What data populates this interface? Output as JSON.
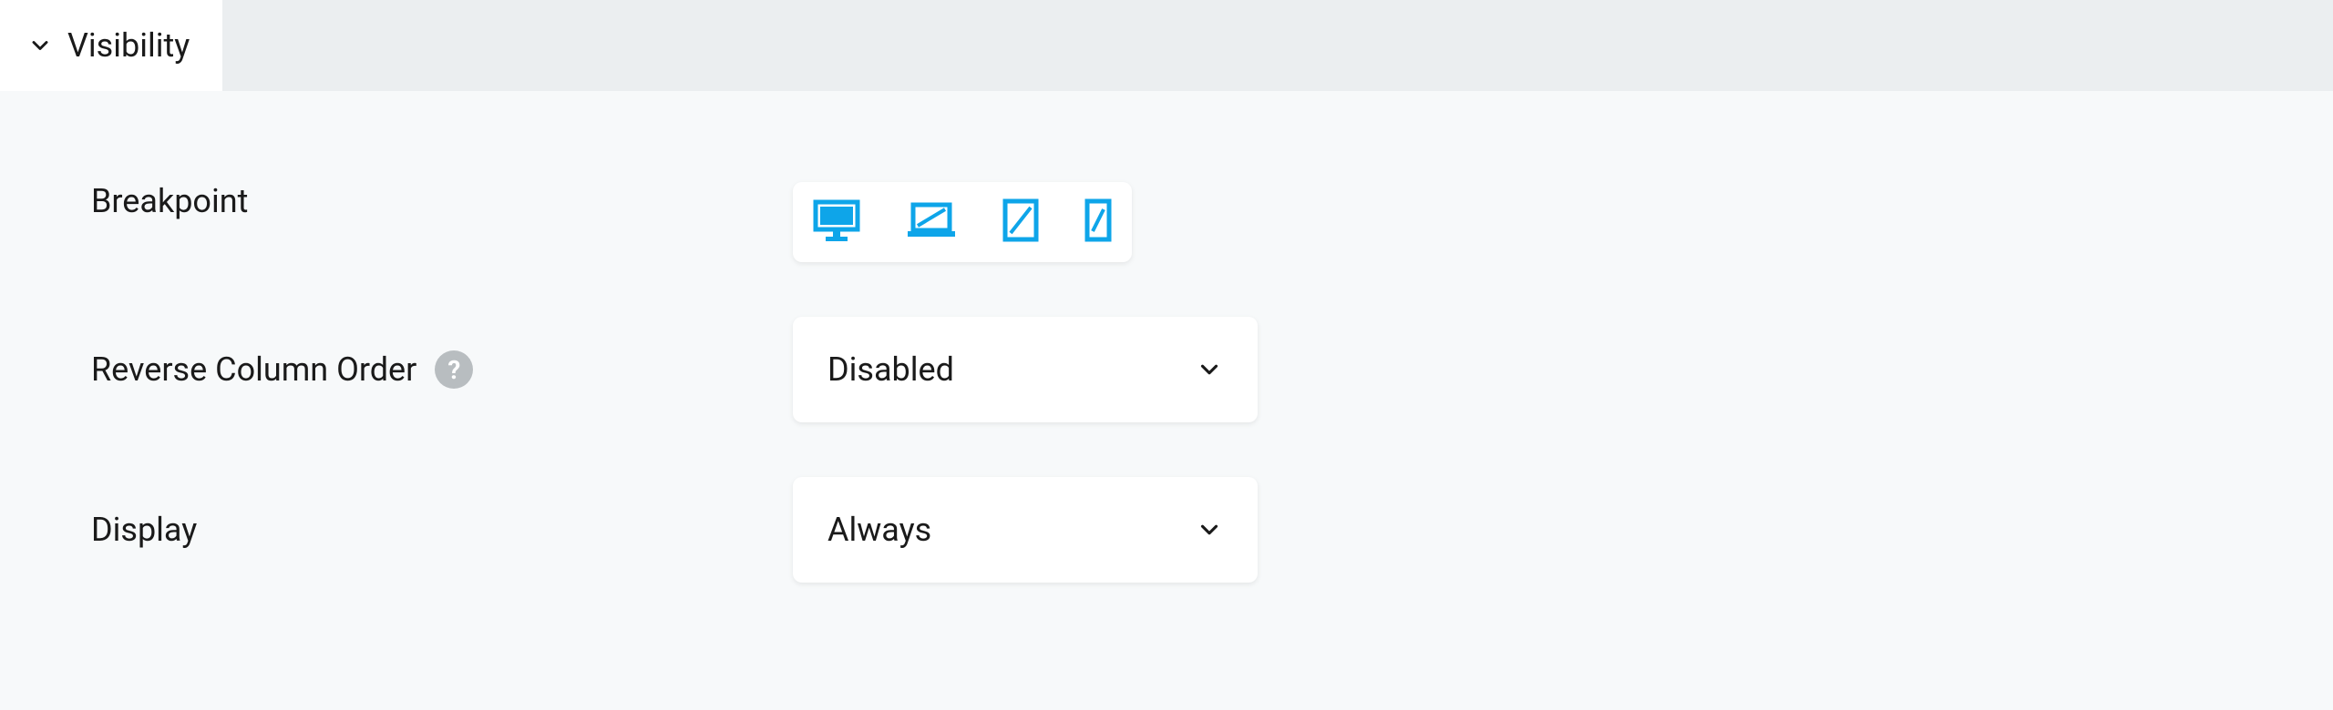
{
  "panel": {
    "title": "Visibility"
  },
  "fields": {
    "breakpoint": {
      "label": "Breakpoint"
    },
    "reverse_column_order": {
      "label": "Reverse Column Order",
      "value": "Disabled"
    },
    "display": {
      "label": "Display",
      "value": "Always"
    }
  },
  "colors": {
    "accent": "#0ea5e9",
    "help_bg": "#b8bdc0",
    "page_bg": "#f7f9fa",
    "header_bg": "#ebeef0"
  }
}
